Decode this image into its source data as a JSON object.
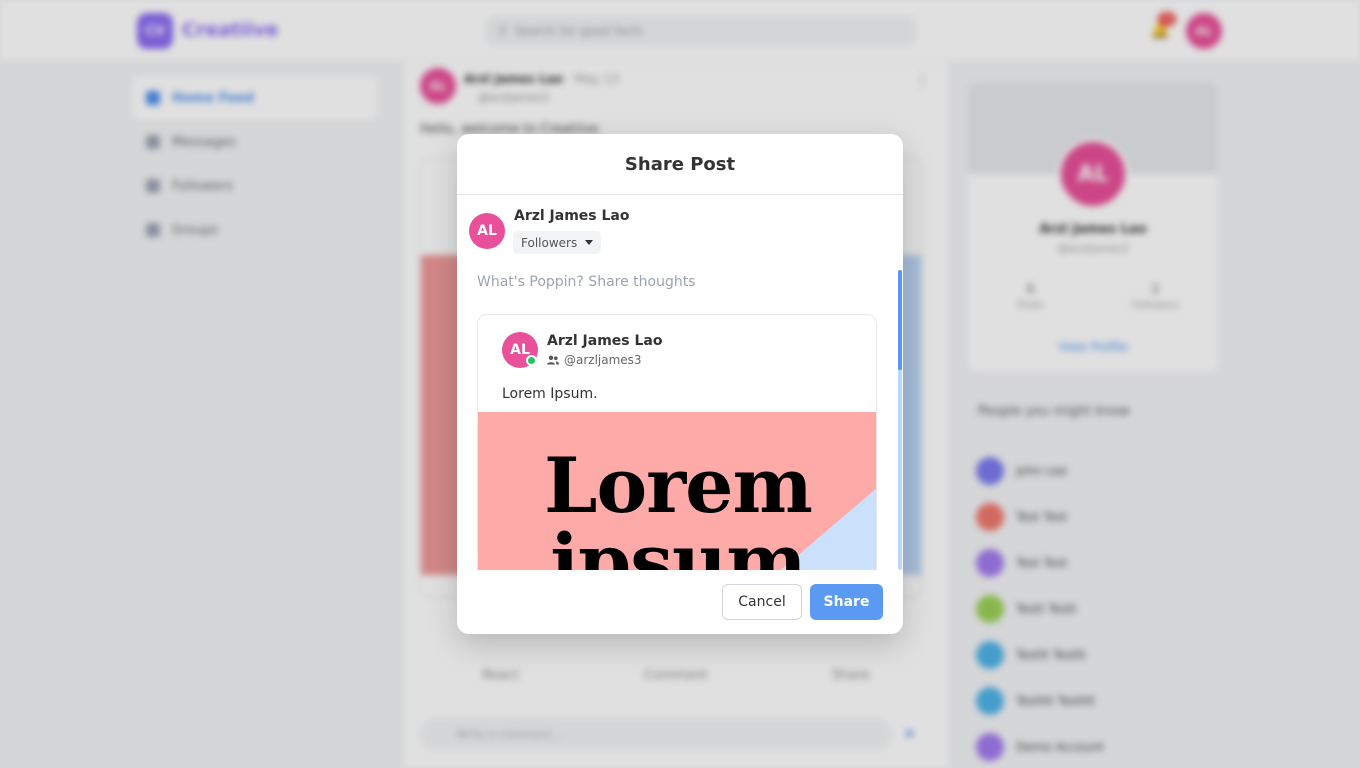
{
  "app": {
    "logo_initials": "CV",
    "brand": "Creatiive",
    "search_placeholder": "Search for good facts",
    "notification_count": "12",
    "user_initials": "AL"
  },
  "sidebar": {
    "items": [
      {
        "label": "Home Feed",
        "active": true
      },
      {
        "label": "Messages",
        "active": false
      },
      {
        "label": "Followers",
        "active": false
      },
      {
        "label": "Groups",
        "active": false
      }
    ]
  },
  "feed": {
    "author_initials": "AL",
    "author_name": "Arzl James Lao",
    "post_date": "· May 13",
    "author_handle": "@arzljames3",
    "post_text": "Hello, welcome to Creatiive",
    "actions": {
      "react": "React",
      "comment": "Comment",
      "share": "Share"
    },
    "comment_placeholder": "Write a comment..."
  },
  "profile": {
    "initials": "AL",
    "name": "Arzl James Lao",
    "handle": "@arzljames3",
    "posts_count": "0",
    "posts_label": "Posts",
    "followers_count": "2",
    "followers_label": "Followers",
    "view_profile": "View Profile"
  },
  "suggestions": {
    "title": "People you might know",
    "people": [
      {
        "name": "John Lee",
        "color": "#7b7bf0"
      },
      {
        "name": "Test Test",
        "color": "#f0786e"
      },
      {
        "name": "Test Test",
        "color": "#a27bf0"
      },
      {
        "name": "Testt Testt",
        "color": "#9ad157"
      },
      {
        "name": "Testtt Testtt",
        "color": "#4fb3e8"
      },
      {
        "name": "Testttt Testttt",
        "color": "#4fb3e8"
      },
      {
        "name": "Demo Account",
        "color": "#a27bf0"
      }
    ]
  },
  "modal": {
    "title": "Share Post",
    "author_initials": "AL",
    "author_name": "Arzl James Lao",
    "audience": "Followers",
    "thoughts_placeholder": "What's Poppin? Share thoughts",
    "shared_post": {
      "initials": "AL",
      "name": "Arzl James Lao",
      "handle": "@arzljames3",
      "text": "Lorem Ipsum.",
      "image_line1": "Lorem",
      "image_line2": "ipsum"
    },
    "cancel_label": "Cancel",
    "share_label": "Share"
  },
  "colors": {
    "accent": "#5b9af2",
    "avatar": "#e9509a",
    "online": "#22c55e",
    "image_pink": "#fdaaa9",
    "image_blue": "#cbe0fa"
  }
}
